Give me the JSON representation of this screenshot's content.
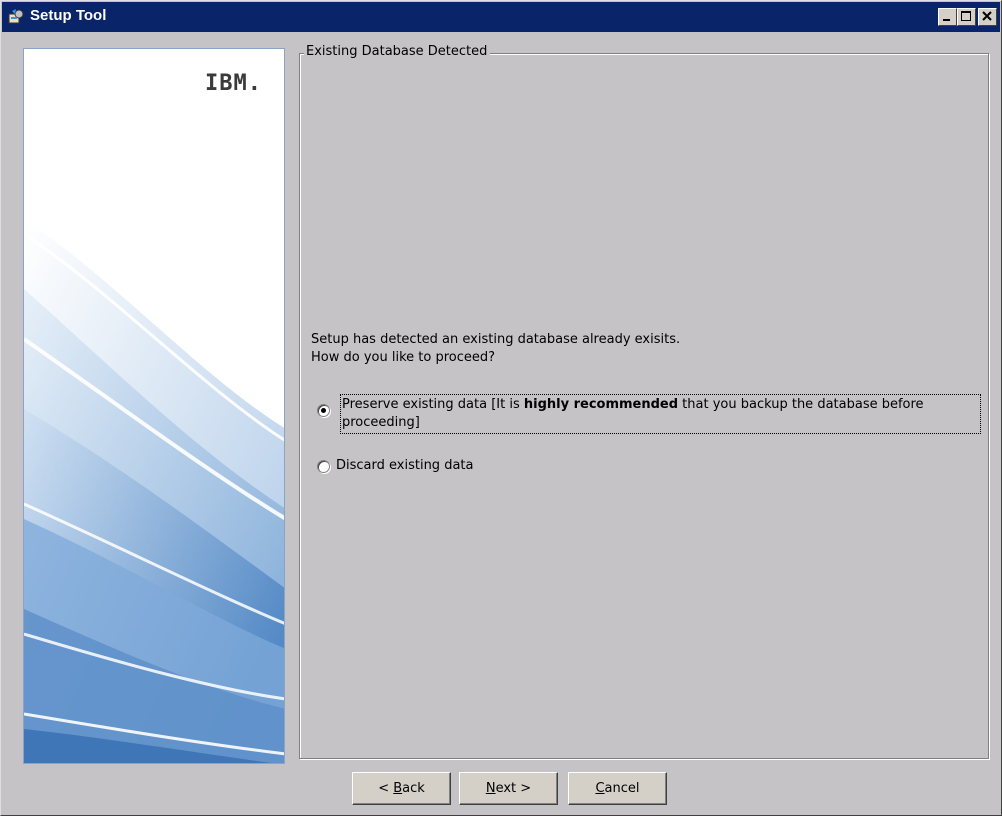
{
  "window": {
    "title": "Setup Tool",
    "controls": [
      "minimize",
      "maximize",
      "close"
    ]
  },
  "side_panel": {
    "logo": "IBM."
  },
  "group": {
    "title": "Existing Database Detected",
    "message_line1": "Setup has detected an existing database already exisits.",
    "message_line2": "How do you like to proceed?",
    "options": [
      {
        "text_before": "Preserve existing data [It is ",
        "text_bold": "highly recommended",
        "text_after": " that you backup the database before proceeding]",
        "selected": true
      },
      {
        "text": "Discard existing data",
        "selected": false
      }
    ]
  },
  "buttons": {
    "back": {
      "prefix": "< ",
      "mnemonic": "B",
      "rest": "ack"
    },
    "next": {
      "mnemonic": "N",
      "rest": "ext >"
    },
    "cancel": {
      "mnemonic": "C",
      "rest": "ancel"
    }
  },
  "colors": {
    "titlebar": "#0a246a",
    "dialog_bg": "#c6c3c6",
    "side_panel_accent": "#5b8fc8"
  }
}
